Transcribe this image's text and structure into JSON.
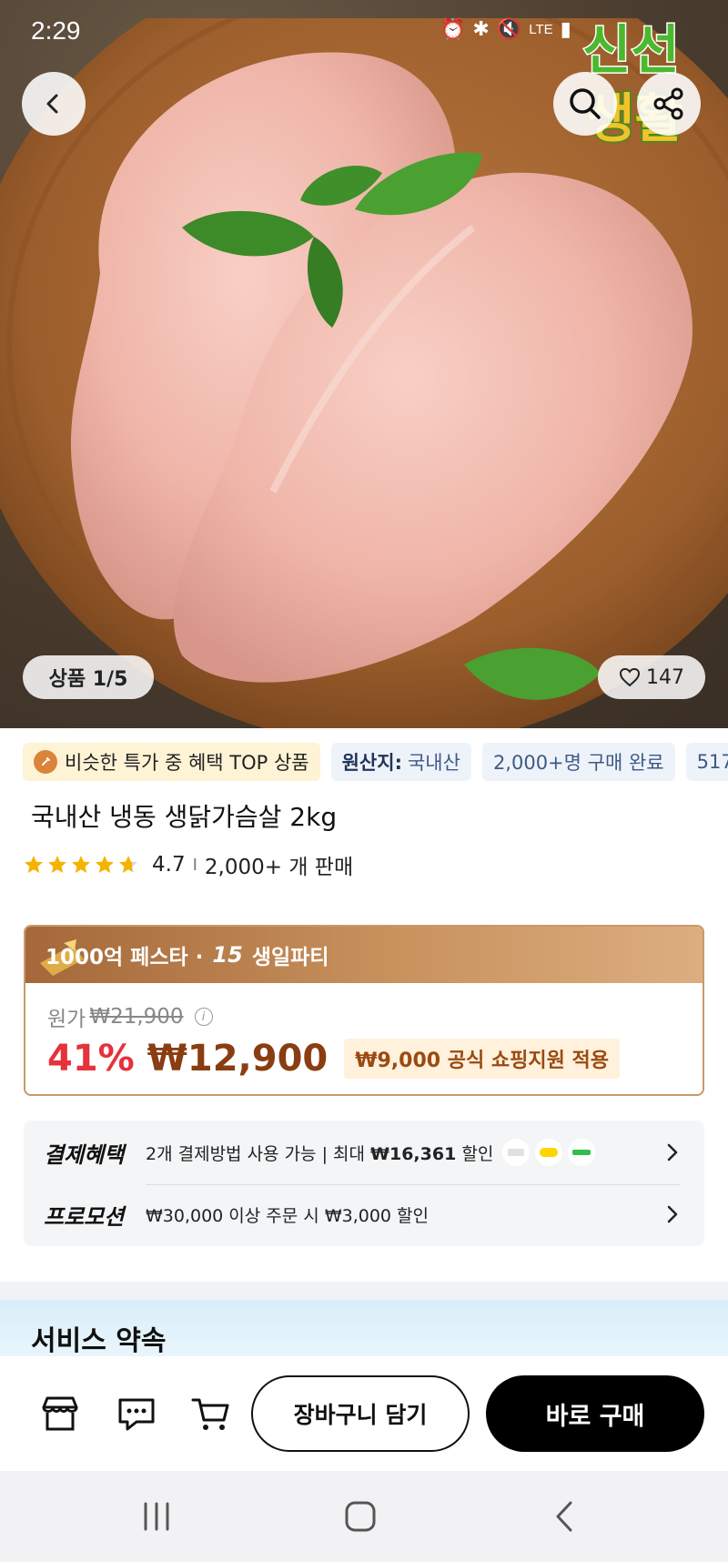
{
  "status_bar": {
    "time": "2:29",
    "network": "LTE"
  },
  "hero": {
    "image_counter": "상품 1/5",
    "like_count": "147",
    "brand_logo_text": "신선생활"
  },
  "tags": [
    {
      "text": "비슷한 특가 중 혜택 TOP 상품",
      "style": "highlight"
    },
    {
      "label": "원산지:",
      "value": "국내산",
      "style": "info"
    },
    {
      "text": "2,000+명 구매 완료",
      "style": "info"
    },
    {
      "text": "517",
      "style": "info"
    }
  ],
  "product": {
    "title": "국내산 냉동 생닭가슴살 2kg",
    "rating": "4.7",
    "rating_stars": 4.7,
    "sales": "2,000+ 개 판매"
  },
  "price_card": {
    "promo_text": "1000억 페스타 · ",
    "promo_badge": "15",
    "promo_text_2": "생일파티",
    "original_label": "원가",
    "original_price": "₩21,900",
    "discount": "41%",
    "sale_price": "₩12,900",
    "support": "₩9,000 공식 쇼핑지원 적용"
  },
  "benefits": {
    "payment_label": "결제혜택",
    "payment_text_1": "2개 결제방법 사용 가능 | 최대 ",
    "payment_amount": "₩16,361",
    "payment_text_2": " 할인",
    "promotion_label": "프로모션",
    "promotion_text": "₩30,000 이상 주문 시 ₩3,000 할인"
  },
  "service": {
    "title": "서비스 약속"
  },
  "actions": {
    "cart_label": "장바구니 담기",
    "buy_label": "바로 구매"
  },
  "colors": {
    "discount_red": "#e5323b",
    "price_brown": "#8a3d12",
    "card_border": "#c9996a"
  }
}
